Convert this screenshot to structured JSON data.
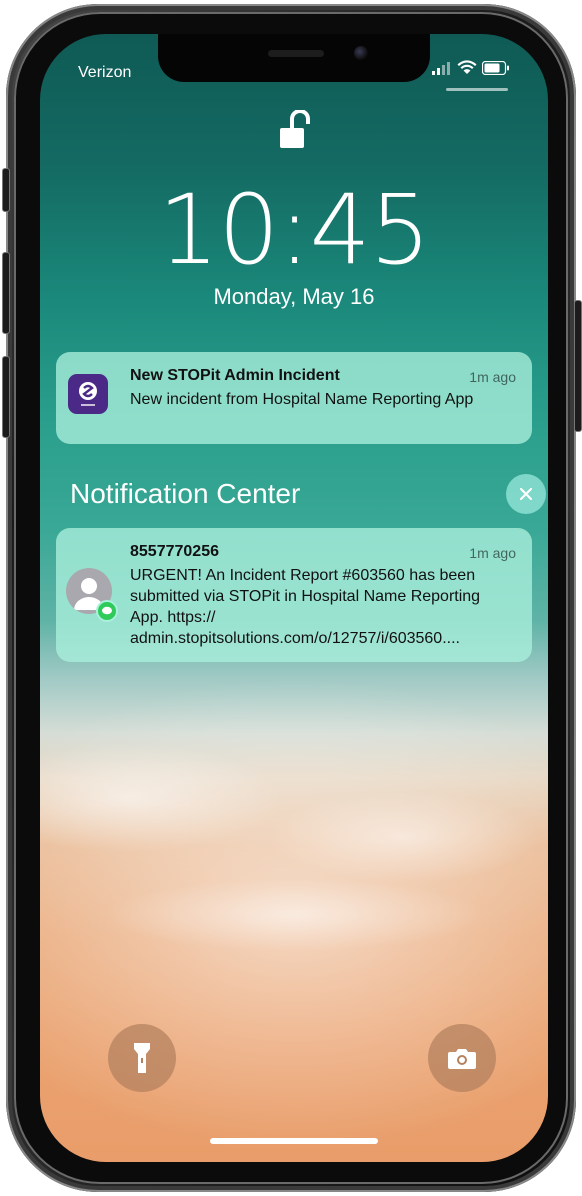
{
  "status_bar": {
    "carrier": "Verizon",
    "icons": [
      "cellular-signal-icon",
      "wifi-icon",
      "battery-icon"
    ]
  },
  "lock_screen": {
    "lock_state": "unlocked",
    "time": "10:45",
    "date": "Monday, May 16"
  },
  "notification_1": {
    "app_icon": "stopit-admin-icon",
    "app_icon_color": "#4a2a86",
    "title": "New STOPit Admin Incident",
    "time": "1m ago",
    "body": "New incident from Hospital Name Reporting App"
  },
  "notification_center": {
    "title": "Notification Center",
    "close_icon": "close-icon"
  },
  "notification_2": {
    "sender": "8557770256",
    "time": "1m ago",
    "body": "URGENT! An Incident Report #603560 has been submitted via STOPit in Hospital Name Reporting App. https:// admin.stopitsolutions.com/o/12757/i/603560...."
  },
  "quick_actions": {
    "flashlight": "flashlight-icon",
    "camera": "camera-icon"
  },
  "colors": {
    "notification_bg": "#aaf0dc",
    "message_badge": "#2fcb5a"
  }
}
